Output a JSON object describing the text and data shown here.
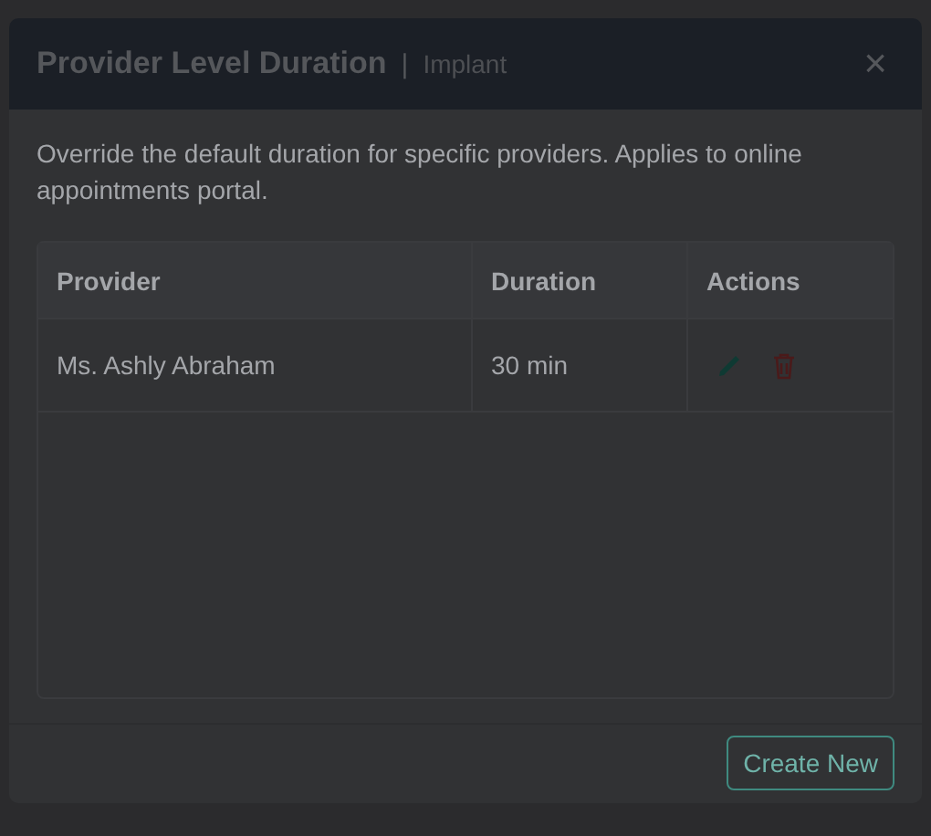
{
  "dialog": {
    "title": "Provider Level Duration",
    "separator": "|",
    "subtitle": "Implant",
    "close": "×"
  },
  "description": "Override the default duration for specific providers. Applies to online appointments portal.",
  "table": {
    "columns": [
      "Provider",
      "Duration",
      "Actions"
    ],
    "rows": [
      {
        "provider": "Ms. Ashly Abraham",
        "duration": "30 min"
      }
    ]
  },
  "buttons": [
    "Create New"
  ]
}
